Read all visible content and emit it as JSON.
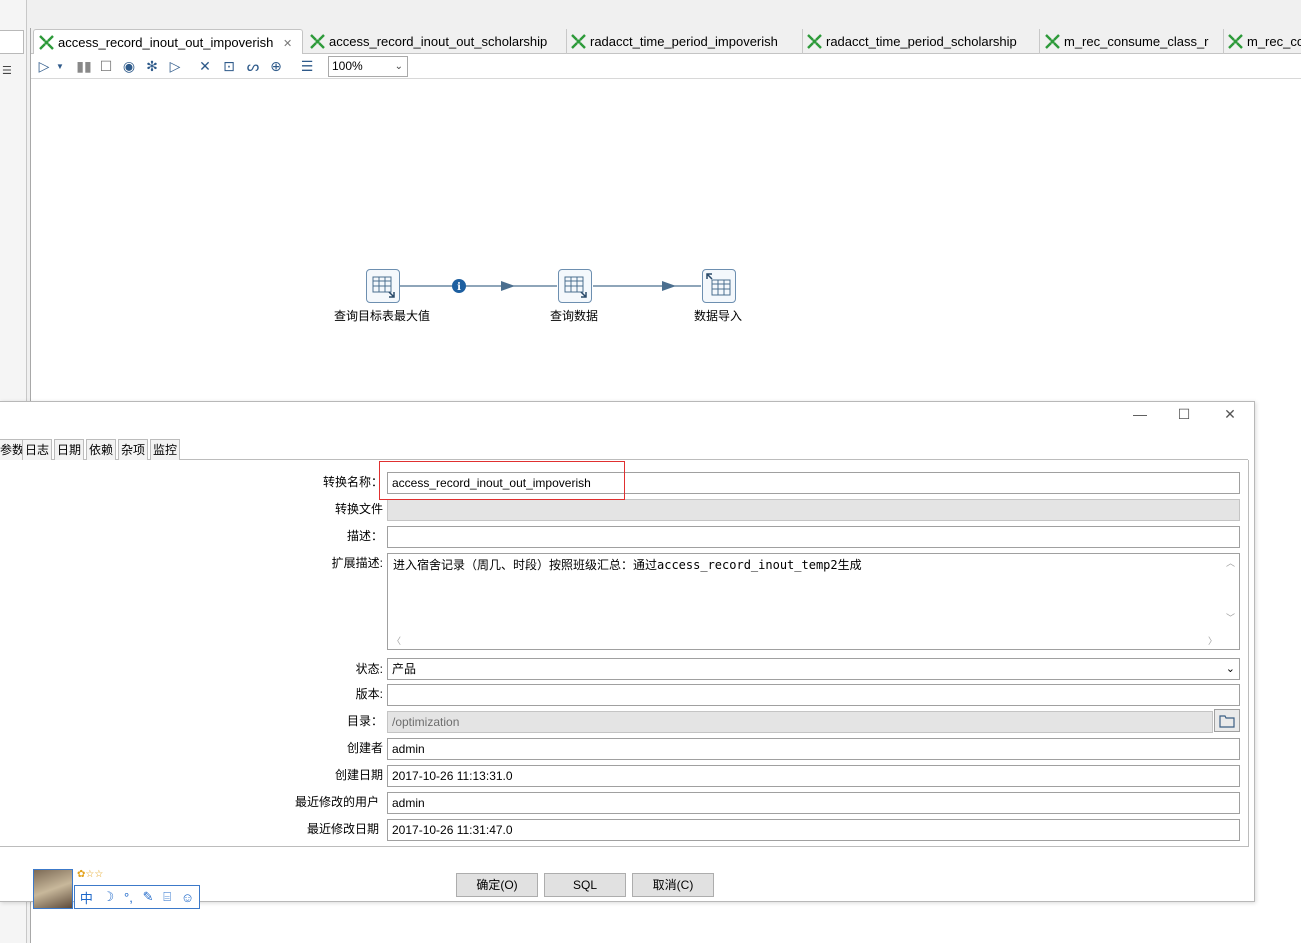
{
  "tabs": [
    {
      "label": "access_record_inout_out_impoverish",
      "active": true
    },
    {
      "label": "access_record_inout_out_scholarship"
    },
    {
      "label": "radacct_time_period_impoverish"
    },
    {
      "label": "radacct_time_period_scholarship"
    },
    {
      "label": "m_rec_consume_class_r"
    },
    {
      "label": "m_rec_con"
    }
  ],
  "toolbar": {
    "zoom": "100%",
    "icons": [
      "run-icon",
      "run-options-icon",
      "pause-icon",
      "stop-icon",
      "preview-icon",
      "debug-icon",
      "replay-icon",
      "verify-icon",
      "analyze-icon",
      "sql-icon",
      "explore-db-icon",
      "show-results-icon"
    ]
  },
  "canvas": {
    "steps": [
      {
        "label": "查询目标表最大值"
      },
      {
        "label": "查询数据"
      },
      {
        "label": "数据导入"
      }
    ],
    "hop_info_icon": "info-icon"
  },
  "dialog": {
    "tabs": [
      "参数",
      "日志",
      "日期",
      "依赖",
      "杂项",
      "监控"
    ],
    "fields": {
      "trans_name_label": "转换名称：",
      "trans_name_value": "access_record_inout_out_impoverish",
      "trans_file_label": "转换文件",
      "trans_file_value": "",
      "description_label": "描述：",
      "description_value": "",
      "ext_description_label": "扩展描述:",
      "ext_description_value": "进入宿舍记录（周几、时段）按照班级汇总：通过access_record_inout_temp2生成",
      "status_label": "状态:",
      "status_value": "产品",
      "version_label": "版本:",
      "version_value": "",
      "directory_label": "目录：",
      "directory_value": "/optimization",
      "created_by_label": "创建者",
      "created_by_value": "admin",
      "created_date_label": "创建日期",
      "created_date_value": "2017-10-26 11:13:31.0",
      "modified_by_label": "最近修改的用户",
      "modified_by_value": "admin",
      "modified_date_label": "最近修改日期",
      "modified_date_value": "2017-10-26 11:31:47.0"
    },
    "buttons": {
      "ok": "确定(O)",
      "sql": "SQL",
      "cancel": "取消(C)"
    }
  },
  "ime": {
    "items": [
      "中",
      "☽",
      "°,",
      "✎",
      "⌸",
      "☺"
    ],
    "stars": "✿☆☆"
  }
}
